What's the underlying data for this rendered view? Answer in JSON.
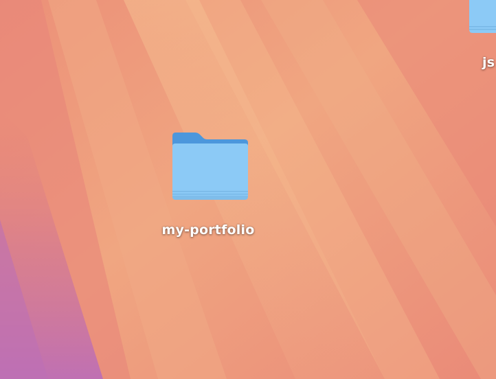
{
  "desktop": {
    "wallpaper": {
      "name": "wallpaper-gradient",
      "colors": {
        "base": "#ee9a7c",
        "light_streak": "#f3b58c",
        "warm_pink": "#ea8576",
        "purple_corner": "#c072b2"
      }
    },
    "icons": [
      {
        "icon": "folder-icon",
        "label": "my-portfolio",
        "selected": false
      },
      {
        "icon": "folder-icon",
        "label": "js",
        "selected": false
      }
    ]
  },
  "folder_colors": {
    "back": "#4c97dc",
    "front": "#8ccaf6",
    "front_bottom": "#7fbdea"
  }
}
